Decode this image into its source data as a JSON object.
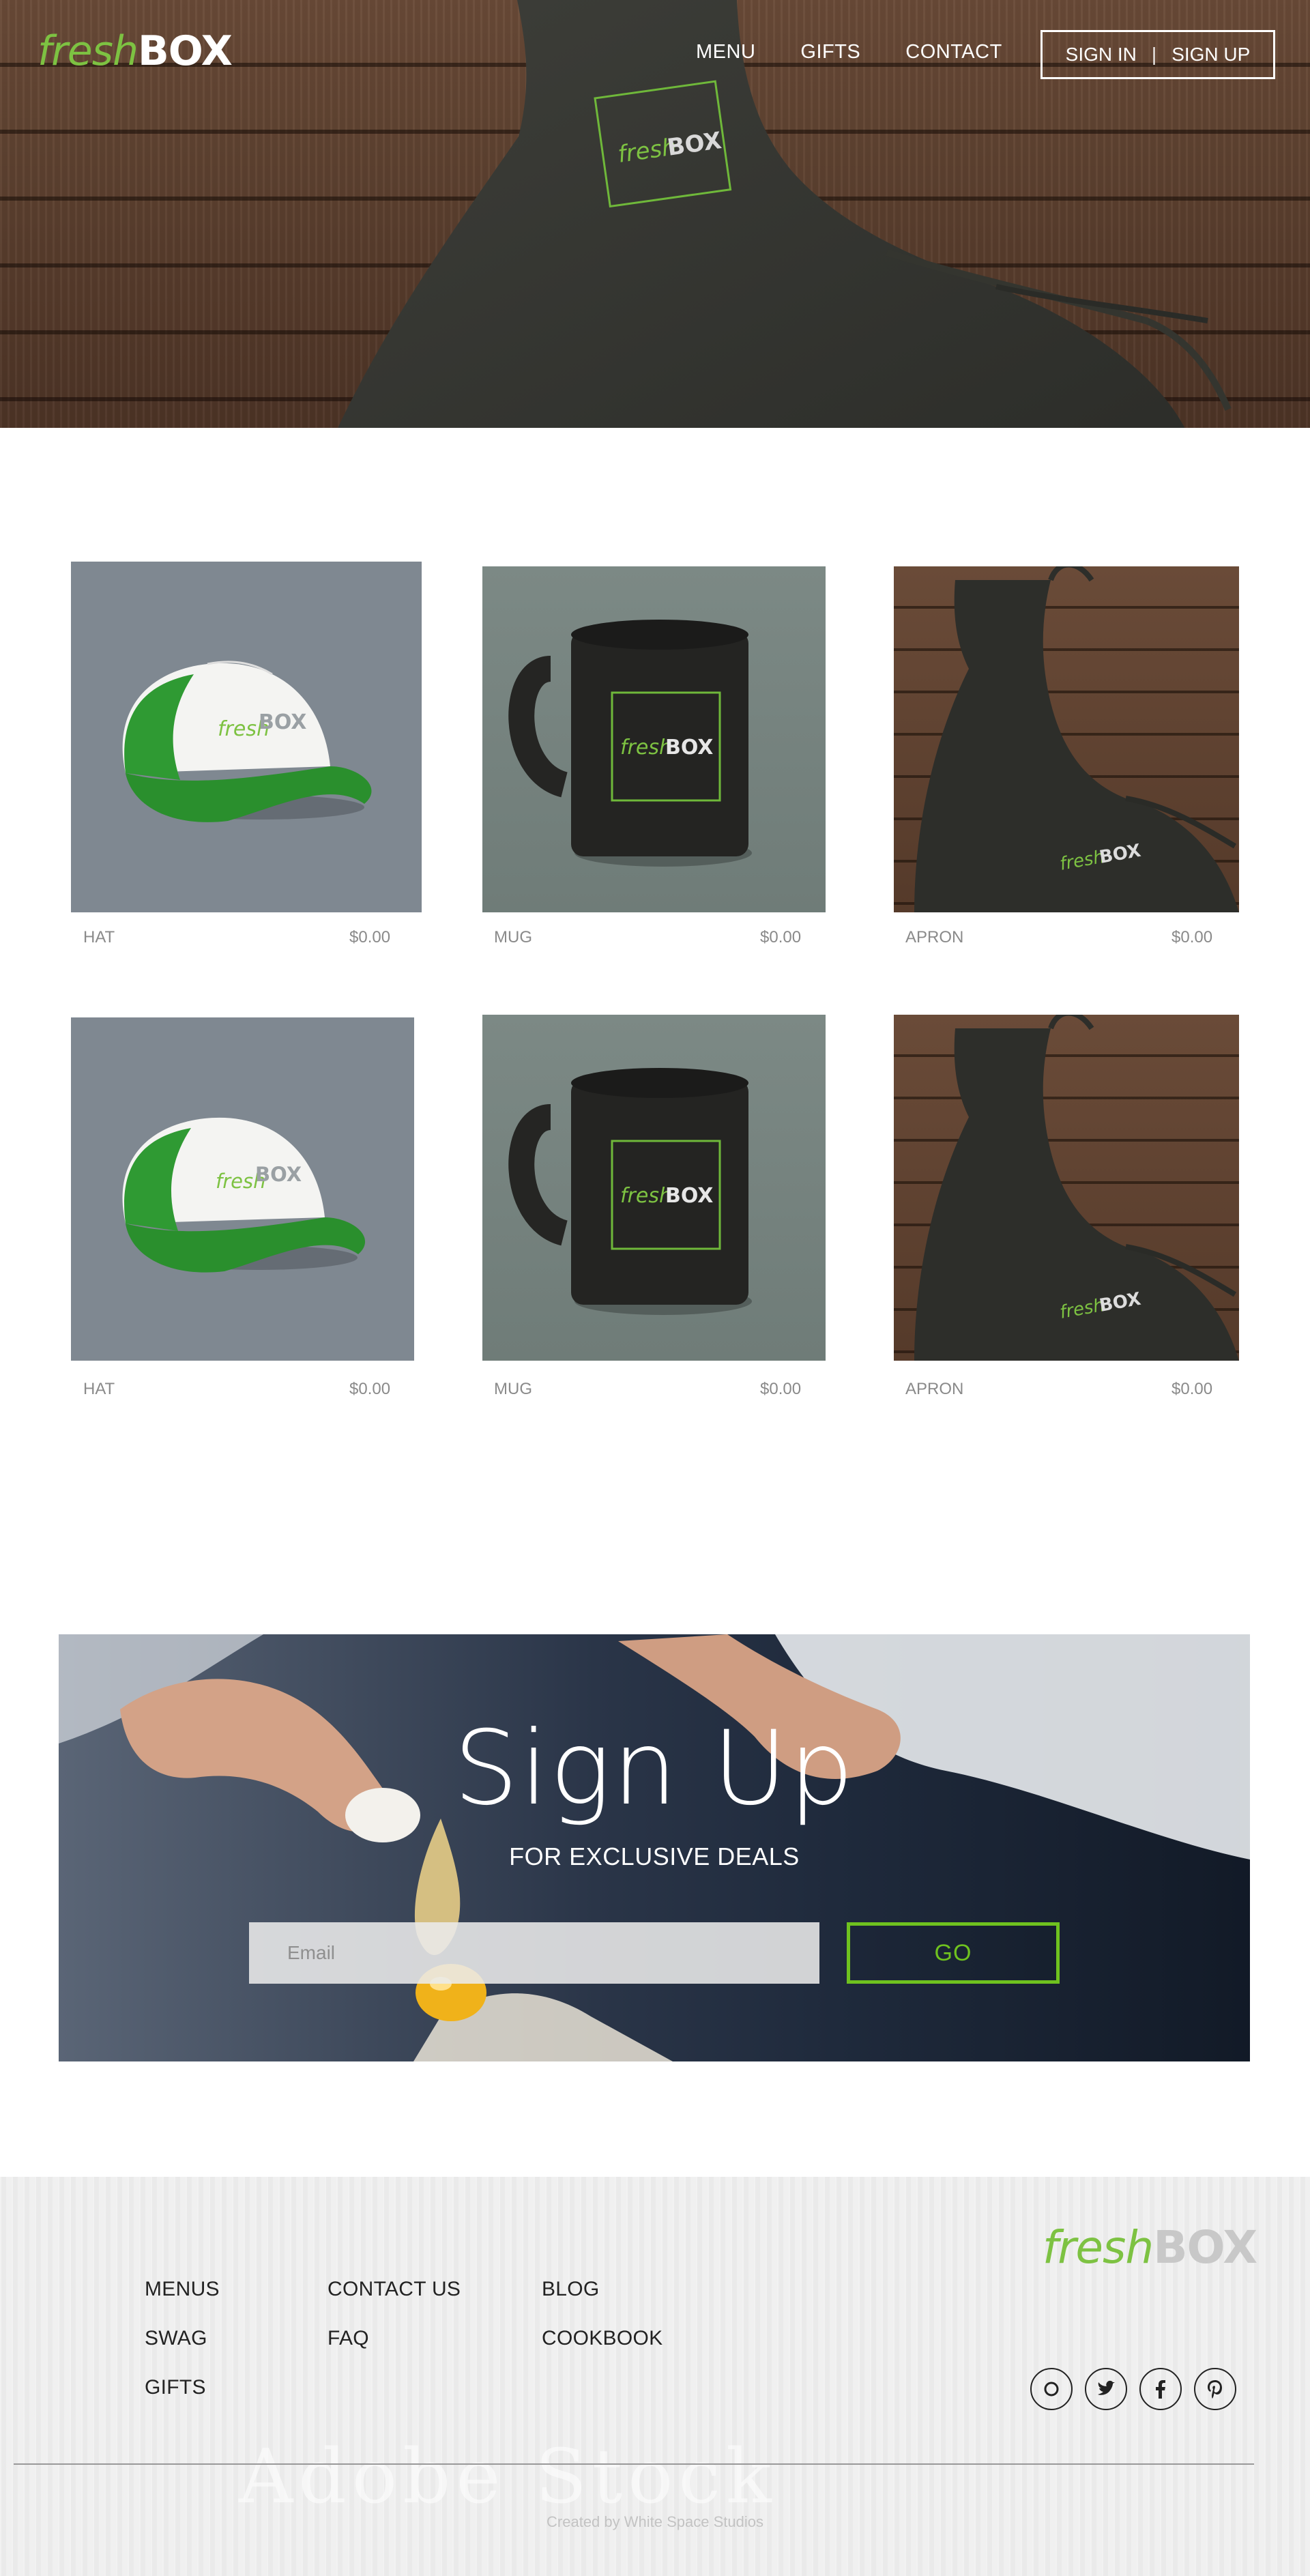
{
  "brand": {
    "fresh": "fresh",
    "box": "BOX",
    "color_green": "#7dc242"
  },
  "nav": {
    "items": [
      "MENU",
      "GIFTS",
      "CONTACT"
    ],
    "sign_in": "SIGN IN",
    "separator": "|",
    "sign_up": "SIGN UP"
  },
  "products": [
    {
      "name": "HAT",
      "price": "$0.00",
      "kind": "hat"
    },
    {
      "name": "MUG",
      "price": "$0.00",
      "kind": "mug"
    },
    {
      "name": "APRON",
      "price": "$0.00",
      "kind": "apron"
    },
    {
      "name": "HAT",
      "price": "$0.00",
      "kind": "hat"
    },
    {
      "name": "MUG",
      "price": "$0.00",
      "kind": "mug"
    },
    {
      "name": "APRON",
      "price": "$0.00",
      "kind": "apron"
    }
  ],
  "signup": {
    "title": "Sign Up",
    "subtitle": "FOR EXCLUSIVE DEALS",
    "email_placeholder": "Email",
    "go_label": "GO",
    "accent": "#6fc21f"
  },
  "footer": {
    "col1": [
      "MENUS",
      "SWAG",
      "GIFTS"
    ],
    "col2": [
      "CONTACT US",
      "FAQ"
    ],
    "col3": [
      "BLOG",
      "COOKBOOK"
    ],
    "social_icons": [
      "instagram-icon",
      "twitter-icon",
      "facebook-icon",
      "pinterest-icon"
    ],
    "watermark": "Adobe Stock",
    "credit": "Created by White Space Studios"
  }
}
